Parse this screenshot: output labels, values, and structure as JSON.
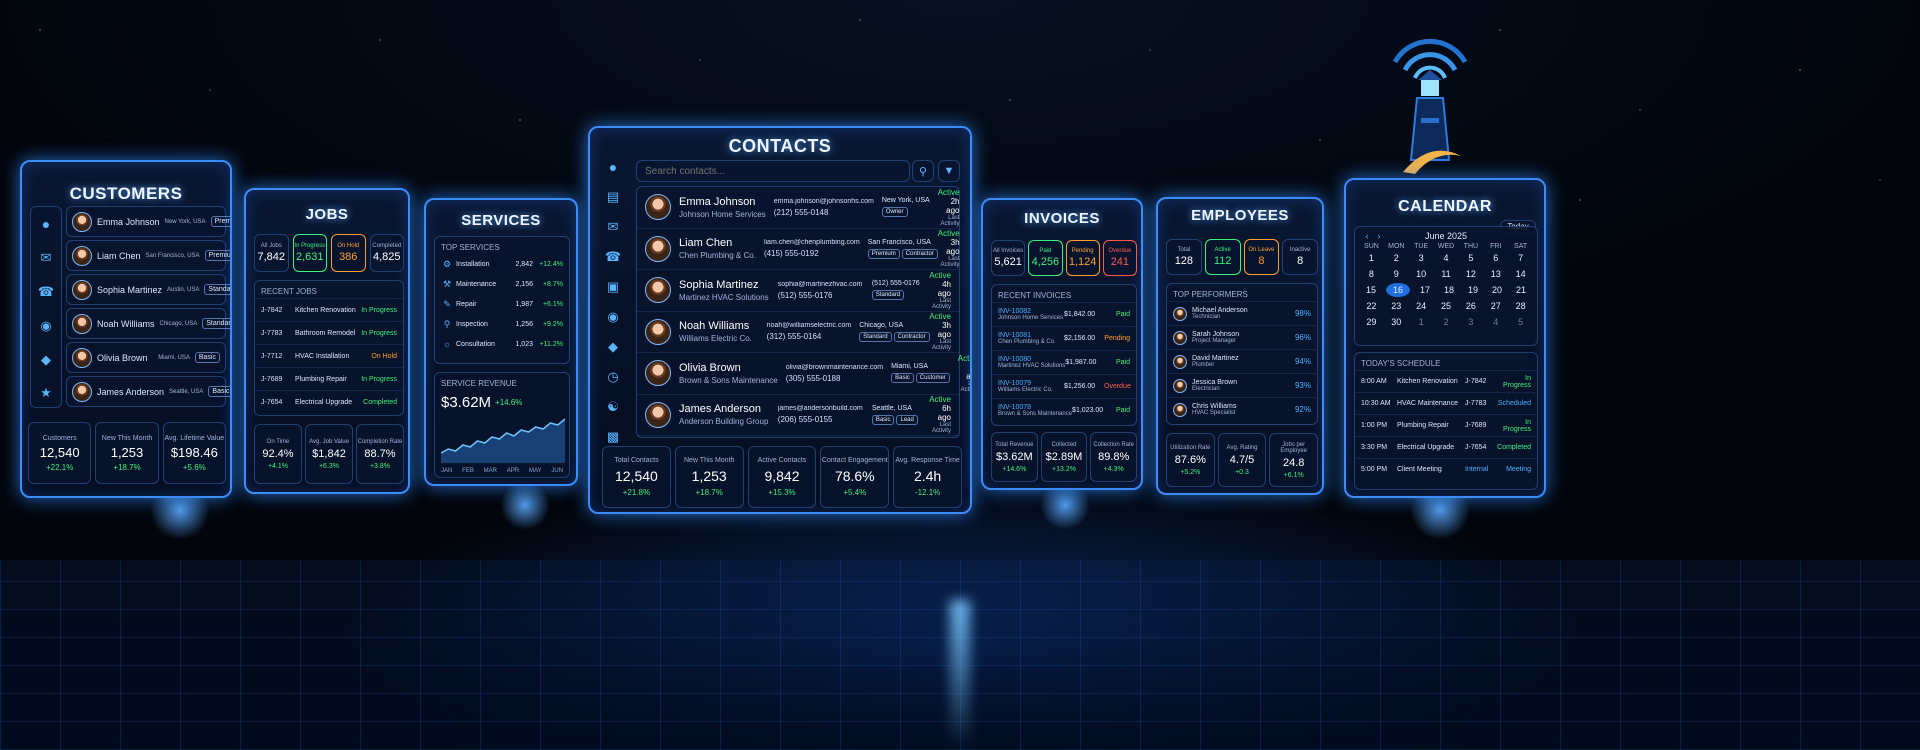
{
  "customers": {
    "title": "CUSTOMERS",
    "rows": [
      {
        "name": "Emma Johnson",
        "loc": "New York, USA",
        "tier": "Premium"
      },
      {
        "name": "Liam Chen",
        "loc": "San Francisco, USA",
        "tier": "Premium"
      },
      {
        "name": "Sophia Martinez",
        "loc": "Austin, USA",
        "tier": "Standard"
      },
      {
        "name": "Noah Williams",
        "loc": "Chicago, USA",
        "tier": "Standard"
      },
      {
        "name": "Olivia Brown",
        "loc": "Miami, USA",
        "tier": "Basic"
      },
      {
        "name": "James Anderson",
        "loc": "Seattle, USA",
        "tier": "Basic"
      }
    ],
    "stats": [
      {
        "label": "Customers",
        "value": "12,540",
        "delta": "+22.1%"
      },
      {
        "label": "New This Month",
        "value": "1,253",
        "delta": "+18.7%"
      },
      {
        "label": "Avg. Lifetime Value",
        "value": "$198.46",
        "delta": "+5.6%"
      }
    ]
  },
  "jobs": {
    "title": "JOBS",
    "top": [
      {
        "label": "All Jobs",
        "value": "7,842"
      },
      {
        "label": "In Progress",
        "value": "2,631"
      },
      {
        "label": "On Hold",
        "value": "386"
      },
      {
        "label": "Completed",
        "value": "4,825"
      }
    ],
    "recent_label": "RECENT JOBS",
    "rows": [
      {
        "id": "J-7842",
        "name": "Kitchen Renovation",
        "status": "In Progress"
      },
      {
        "id": "J-7783",
        "name": "Bathroom Remodel",
        "status": "In Progress"
      },
      {
        "id": "J-7712",
        "name": "HVAC Installation",
        "status": "On Hold"
      },
      {
        "id": "J-7689",
        "name": "Plumbing Repair",
        "status": "In Progress"
      },
      {
        "id": "J-7654",
        "name": "Electrical Upgrade",
        "status": "Completed"
      }
    ],
    "stats": [
      {
        "label": "On Time",
        "value": "92.4%",
        "delta": "+4.1%"
      },
      {
        "label": "Avg. Job Value",
        "value": "$1,842",
        "delta": "+6.3%"
      },
      {
        "label": "Completion Rate",
        "value": "88.7%",
        "delta": "+3.8%"
      }
    ]
  },
  "services": {
    "title": "SERVICES",
    "top_label": "TOP SERVICES",
    "rows": [
      {
        "name": "Installation",
        "count": "2,842",
        "delta": "+12.4%"
      },
      {
        "name": "Maintenance",
        "count": "2,156",
        "delta": "+8.7%"
      },
      {
        "name": "Repair",
        "count": "1,987",
        "delta": "+6.1%"
      },
      {
        "name": "Inspection",
        "count": "1,256",
        "delta": "+9.2%"
      },
      {
        "name": "Consultation",
        "count": "1,023",
        "delta": "+11.2%"
      }
    ],
    "revenue_label": "SERVICE REVENUE",
    "revenue": "$3.62M",
    "revenue_delta": "+14.6%",
    "months": [
      "JAN",
      "FEB",
      "MAR",
      "APR",
      "MAY",
      "JUN"
    ],
    "trend": [
      10,
      14,
      12,
      18,
      16,
      22,
      20,
      26,
      24,
      30,
      27,
      33,
      31,
      36,
      34,
      40,
      38,
      44
    ]
  },
  "contacts": {
    "title": "CONTACTS",
    "search_placeholder": "Search contacts...",
    "rows": [
      {
        "name": "Emma Johnson",
        "company": "Johnson Home Services",
        "email": "emma.johnson@johnsonhs.com",
        "phone": "(212) 555-0148",
        "loc": "New York, USA",
        "tags": [
          "Owner"
        ],
        "status": "Active",
        "ago": "2h ago",
        "last": "Last Activity"
      },
      {
        "name": "Liam Chen",
        "company": "Chen Plumbing & Co.",
        "email": "liam.chen@chenplumbing.com",
        "phone": "(415) 555-0192",
        "loc": "San Francisco, USA",
        "tags": [
          "Premium",
          "Contractor"
        ],
        "status": "Active",
        "ago": "3h ago",
        "last": "Last Activity"
      },
      {
        "name": "Sophia Martinez",
        "company": "Martinez HVAC Solutions",
        "email": "sophia@martinezhvac.com",
        "phone": "(512) 555-0176",
        "loc": "(512) 555-0176",
        "tags": [
          "Standard"
        ],
        "status": "Active",
        "ago": "4h ago",
        "last": "Last Activity"
      },
      {
        "name": "Noah Williams",
        "company": "Williams Electric Co.",
        "email": "noah@williamselectric.com",
        "phone": "(312) 555-0164",
        "loc": "Chicago, USA",
        "tags": [
          "Standard",
          "Contractor"
        ],
        "status": "Active",
        "ago": "3h ago",
        "last": "Last Activity"
      },
      {
        "name": "Olivia Brown",
        "company": "Brown & Sons Maintenance",
        "email": "olivia@brownmaintenance.com",
        "phone": "(305) 555-0188",
        "loc": "Miami, USA",
        "tags": [
          "Basic",
          "Customer"
        ],
        "status": "Active",
        "ago": "5h ago",
        "last": "Last Activity"
      },
      {
        "name": "James Anderson",
        "company": "Anderson Building Group",
        "email": "james@andersonbuild.com",
        "phone": "(206) 555-0155",
        "loc": "Seattle, USA",
        "tags": [
          "Basic",
          "Lead"
        ],
        "status": "Active",
        "ago": "6h ago",
        "last": "Last Activity"
      }
    ],
    "stats": [
      {
        "label": "Total Contacts",
        "value": "12,540",
        "delta": "+21.8%"
      },
      {
        "label": "New This Month",
        "value": "1,253",
        "delta": "+18.7%"
      },
      {
        "label": "Active Contacts",
        "value": "9,842",
        "delta": "+15.3%"
      },
      {
        "label": "Contact Engagement",
        "value": "78.6%",
        "delta": "+5.4%"
      },
      {
        "label": "Avg. Response Time",
        "value": "2.4h",
        "delta": "-12.1%"
      }
    ]
  },
  "invoices": {
    "title": "INVOICES",
    "top": [
      {
        "label": "All Invoices",
        "value": "5,621"
      },
      {
        "label": "Paid",
        "value": "4,256"
      },
      {
        "label": "Pending",
        "value": "1,124"
      },
      {
        "label": "Overdue",
        "value": "241"
      }
    ],
    "recent_label": "RECENT INVOICES",
    "rows": [
      {
        "id": "INV-10082",
        "client": "Johnson Home Services",
        "amount": "$1,842.00",
        "status": "Paid"
      },
      {
        "id": "INV-10081",
        "client": "Chen Plumbing & Co.",
        "amount": "$2,156.00",
        "status": "Pending"
      },
      {
        "id": "INV-10080",
        "client": "Martinez HVAC Solutions",
        "amount": "$1,987.00",
        "status": "Paid"
      },
      {
        "id": "INV-10079",
        "client": "Williams Electric Co.",
        "amount": "$1,256.00",
        "status": "Overdue"
      },
      {
        "id": "INV-10078",
        "client": "Brown & Sons Maintenance",
        "amount": "$1,023.00",
        "status": "Paid"
      }
    ],
    "stats": [
      {
        "label": "Total Revenue",
        "value": "$3.62M",
        "delta": "+14.6%"
      },
      {
        "label": "Collected",
        "value": "$2.89M",
        "delta": "+13.2%"
      },
      {
        "label": "Collection Rate",
        "value": "89.8%",
        "delta": "+4.3%"
      }
    ]
  },
  "employees": {
    "title": "EMPLOYEES",
    "top": [
      {
        "label": "Total",
        "value": "128"
      },
      {
        "label": "Active",
        "value": "112"
      },
      {
        "label": "On Leave",
        "value": "8"
      },
      {
        "label": "Inactive",
        "value": "8"
      }
    ],
    "perf_label": "TOP PERFORMERS",
    "rows": [
      {
        "name": "Michael Anderson",
        "role": "Technician",
        "pct": "98%"
      },
      {
        "name": "Sarah Johnson",
        "role": "Project Manager",
        "pct": "96%"
      },
      {
        "name": "David Martinez",
        "role": "Plumber",
        "pct": "94%"
      },
      {
        "name": "Jessica Brown",
        "role": "Electrician",
        "pct": "93%"
      },
      {
        "name": "Chris Williams",
        "role": "HVAC Specialist",
        "pct": "92%"
      }
    ],
    "stats": [
      {
        "label": "Utilization Rate",
        "value": "87.6%",
        "delta": "+5.2%"
      },
      {
        "label": "Avg. Rating",
        "value": "4.7/5",
        "delta": "+0.3"
      },
      {
        "label": "Jobs per Employee",
        "value": "24.8",
        "delta": "+6.1%"
      }
    ]
  },
  "calendar": {
    "title": "CALENDAR",
    "today": "Today",
    "month": "June 2025",
    "days": [
      "SUN",
      "MON",
      "TUE",
      "WED",
      "THU",
      "FRI",
      "SAT"
    ],
    "weeks": [
      [
        "1",
        "2",
        "3",
        "4",
        "5",
        "6",
        "7"
      ],
      [
        "8",
        "9",
        "10",
        "11",
        "12",
        "13",
        "14"
      ],
      [
        "15",
        "16",
        "17",
        "18",
        "19",
        "20",
        "21"
      ],
      [
        "22",
        "23",
        "24",
        "25",
        "26",
        "27",
        "28"
      ],
      [
        "29",
        "30",
        "1",
        "2",
        "3",
        "4",
        "5"
      ]
    ],
    "selected": "16",
    "sched_label": "TODAY'S SCHEDULE",
    "schedule": [
      {
        "time": "8:00 AM",
        "title": "Kitchen Renovation",
        "job": "J-7842",
        "status": "In Progress"
      },
      {
        "time": "10:30 AM",
        "title": "HVAC Maintenance",
        "job": "J-7783",
        "status": "Scheduled"
      },
      {
        "time": "1:00 PM",
        "title": "Plumbing Repair",
        "job": "J-7689",
        "status": "In Progress"
      },
      {
        "time": "3:30 PM",
        "title": "Electrical Upgrade",
        "job": "J-7654",
        "status": "Completed"
      },
      {
        "time": "5:00 PM",
        "title": "Client Meeting",
        "job": "Internal",
        "status": "Meeting"
      }
    ]
  },
  "colors": {
    "accent": "#3d8cff",
    "green": "#3ff07a",
    "orange": "#ff9e2c",
    "red": "#ff5a4d"
  }
}
